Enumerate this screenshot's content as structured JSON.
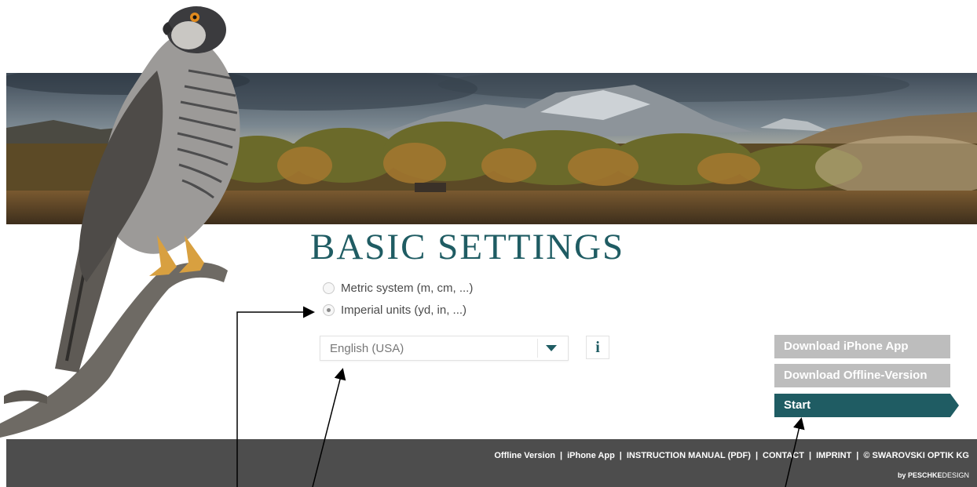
{
  "banner": {
    "image": "mountain-forest-landscape"
  },
  "bird": {
    "image": "hawk-on-branch"
  },
  "settings": {
    "title": "BASIC SETTINGS",
    "unit_options": [
      {
        "label": "Metric system (m, cm, ...)",
        "selected": false
      },
      {
        "label": "Imperial units (yd, in, ...)",
        "selected": true
      }
    ],
    "language": {
      "value": "English (USA)"
    },
    "info_label": "i"
  },
  "actions": {
    "download_iphone": "Download iPhone App",
    "download_offline": "Download Offline-Version",
    "start": "Start"
  },
  "footer": {
    "links": [
      "Offline Version",
      "iPhone App",
      "INSTRUCTION MANUAL (PDF)",
      "CONTACT",
      "IMPRINT",
      "© SWAROVSKI OPTIK KG"
    ],
    "separator": "|",
    "credit_prefix": "by",
    "credit_name": "PESCHKE",
    "credit_suffix": "DESIGN"
  },
  "colors": {
    "accent": "#1f5c63",
    "grey_button": "#bdbdbd",
    "footer_bg": "#4d4d4d"
  }
}
